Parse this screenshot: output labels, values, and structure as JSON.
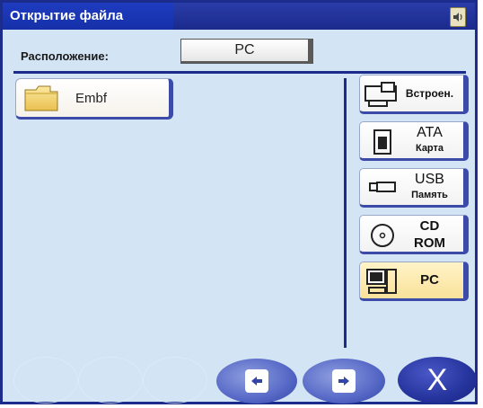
{
  "window": {
    "title": "Открытие файла"
  },
  "location": {
    "label": "Расположение:",
    "value": "PC"
  },
  "files": [
    {
      "name": "Embf",
      "type": "folder"
    }
  ],
  "devices": [
    {
      "id": "embedded",
      "icon": "embroidery-machine-icon",
      "label": "Встроен."
    },
    {
      "id": "ata",
      "icon": "ata-card-icon",
      "line1": "ATA",
      "line2": "Карта"
    },
    {
      "id": "usb",
      "icon": "usb-drive-icon",
      "line1": "USB",
      "line2": "Память"
    },
    {
      "id": "cd",
      "icon": "cd-rom-icon",
      "line1": "CD",
      "line2": "ROM"
    },
    {
      "id": "pc",
      "icon": "computer-icon",
      "label": "PC",
      "selected": true
    }
  ],
  "bottom_bar": {
    "prev_icon": "arrow-left-icon",
    "next_icon": "arrow-right-icon",
    "close_label": "X"
  }
}
